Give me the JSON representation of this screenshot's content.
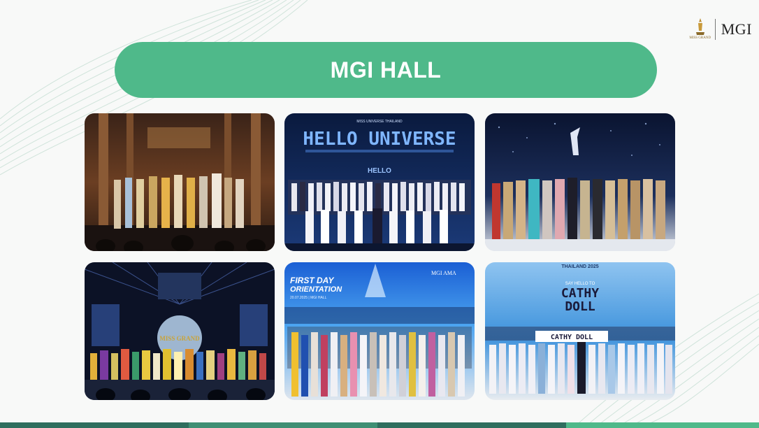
{
  "slide": {
    "title": "MGI HALL",
    "accent_color": "#4fb98a"
  },
  "logo": {
    "crown_text": "MISS GRAND",
    "brand": "MGI"
  },
  "photos": [
    {
      "caption": ""
    },
    {
      "heading": "HELLO UNIVERSE",
      "subheading": "MISS UNIVERSE THAILAND",
      "screen_text": "HELLO"
    },
    {
      "caption": ""
    },
    {
      "screen_text": "MISS GRAND"
    },
    {
      "heading_line1": "FIRST DAY",
      "heading_line2": "ORIENTATION",
      "date_text": "20.07.2025 | MGI HALL",
      "logos": "MGI AMA"
    },
    {
      "top_text": "THAILAND 2025",
      "sub": "SAY HELLO TO",
      "brand_line1": "CATHY",
      "brand_line2": "DOLL",
      "banner": "CATHY DOLL"
    }
  ]
}
